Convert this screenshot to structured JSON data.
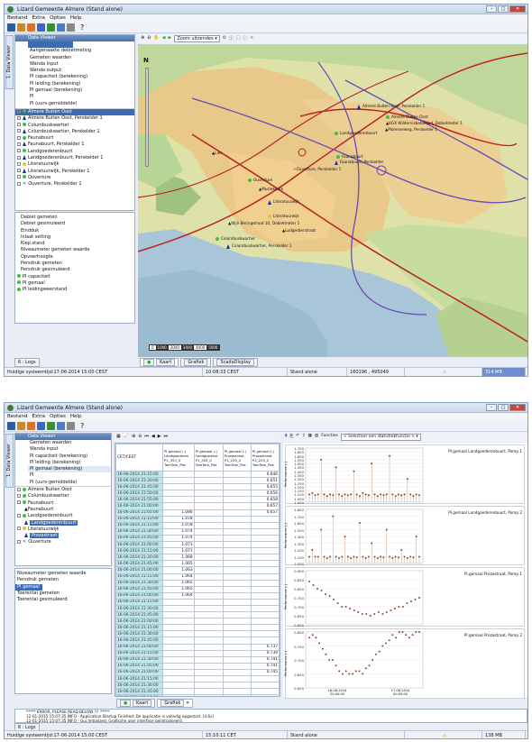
{
  "app": {
    "title": "Lizard Gemeente Almere (Stand alone)",
    "title2": "Lizard Gemeente Almere (Stand alone)"
  },
  "menu": [
    "Bestand",
    "Extra",
    "Opties",
    "Help"
  ],
  "data_viewer": {
    "title": "Data Viewer",
    "side_tab": "1: Data Viewer",
    "logs_tab": "6 : Logs"
  },
  "tree_top": [
    "Aangenaakte debietmeting",
    "Gemeten waarden",
    "Wanda input",
    "Wanda output",
    "PI capaciteit (berekening)",
    "PI leiding (berekening)",
    "PI gemaal (berekening)",
    "PI",
    "PI (uurs-gemiddelde)"
  ],
  "tree_locations": [
    "Almere Buiten Oost",
    "Almere Buiten Oost, Perskelder 1",
    "Columbuskwartier",
    "Columbuskwartier, Perskelder 1",
    "Faunabuurt",
    "Faunabuurt, Perskelder 1",
    "Landgoederenbuurt",
    "Landgoederenbuurt, Perskelder 1",
    "Literatuurwijk",
    "Literatuurwijk, Perskelder 1",
    "Ouverture",
    "Ouverture, Perskelder 1"
  ],
  "params": [
    "Debiet gemeten",
    "Debiet gesimuleerd",
    "Eindduk",
    "Inlaat setting",
    "Klep.stand",
    "Niveaumeter gemeten waarde",
    "Opvoerhoogte",
    "Persdruk gemeten",
    "Persdruk gesimuleerd",
    "PI capaciteit",
    "PI gemaal",
    "PI leidingweerstand"
  ],
  "map": {
    "zoom_option": "Zoom uitzendes",
    "scale_labels": [
      "1000",
      "2000",
      "3000",
      "4000",
      "5000"
    ],
    "north": "N",
    "labels": [
      "Almere Buiten Oost, Perskelder 1",
      "Almere Buiten Oost",
      "KGX Wildernisbebouwd, Debietmeter 1",
      "Molenveweg, Perskelder 1",
      "Landgoederenbuurt",
      "Faunabuurt",
      "Faunabuurt, Perskelder",
      "Lies",
      "Ouverture, Perskelder 1",
      "Ouverture",
      "Muziekpark",
      "Literatuurwijk",
      "Literatuurwijk",
      "Wijn Beringstraat 10, Debietmeter 1",
      "Ludgerberstraat",
      "Columbuskwartier",
      "Columbuskwartier, Perskelder 1"
    ]
  },
  "bottom_tabs": [
    "Kaart",
    "Grafiek",
    "ScadaDisplay"
  ],
  "status1": [
    "Huidige systeemtijd:17-06-2014 15:00 CEST",
    "10:08:33 CEST",
    "Stand alone",
    "160196 , 495049",
    "",
    "314 MB"
  ],
  "table": {
    "headers": [
      "CET/CEST",
      "PI gemaal (-) Landgoederen P1_353_0 TamTam_Pos",
      "PI gemaal (-) Landgoedere P1_353_0 TamTam_Pos",
      "PI gemaal (-) Prozastraat, P1_229_0 TamTam_Pos",
      "PI gemaal (-) Prozastraat, P2_229_0 TamTam_Pos"
    ],
    "times": [
      "16-06-2014 21:15:00",
      "16-06-2014 21:30:00",
      "16-06-2014 21:45:00",
      "16-06-2014 21:50:00",
      "16-06-2014 21:55:00",
      "16-06-2014 21:00:00",
      "16-06-2014 21:05:00",
      "16-06-2014 21:10:00",
      "16-06-2014 21:15:00",
      "16-06-2014 21:30:00",
      "16-06-2014 21:45:00",
      "16-06-2014 21:00:00",
      "16-06-2014 21:15:00",
      "16-06-2014 21:30:00",
      "16-06-2014 21:45:00",
      "16-06-2014 21:00:00",
      "16-06-2014 21:15:00",
      "16-06-2014 21:30:00",
      "16-06-2014 21:45:00",
      "16-06-2014 21:00:00",
      "16-06-2014 21:15:00",
      "16-06-2014 21:30:00",
      "16-06-2014 21:45:00",
      "16-06-2014 21:00:00",
      "16-06-2014 21:15:00",
      "16-06-2014 21:30:00",
      "16-06-2014 21:45:00",
      "16-06-2014 21:00:00",
      "16-06-2014 21:15:00",
      "16-06-2014 21:30:00",
      "16-06-2014 21:45:00",
      "16-06-2014 21:00:00",
      "16-06-2014 21:15:00",
      "16-06-2014 21:30:00",
      "16-06-2014 21:45:00",
      "16-06-2014 21:00:00",
      "16-06-2014 21:15:00",
      "16-06-2014 21:30:00",
      "16-06-2014 21:45:00"
    ],
    "c2": [
      "",
      "",
      "",
      "",
      "",
      "",
      "1.086",
      "1.078",
      "1.078",
      "1.074",
      "1.074",
      "1.073",
      "1.071",
      "1.068",
      "1.065",
      "1.063",
      "1.064",
      "1.065",
      "1.065",
      "1.064",
      "",
      "",
      "",
      "",
      "",
      "",
      "",
      "",
      "",
      "",
      "",
      "",
      "",
      "",
      "",
      "",
      "",
      "",
      ""
    ],
    "c4": [
      "0.646",
      "0.651",
      "0.655",
      "0.656",
      "0.658",
      "0.657",
      "0.657",
      "",
      "",
      "",
      "",
      "",
      "",
      "",
      "",
      "",
      "",
      "",
      "",
      "",
      "",
      "",
      "",
      "",
      "",
      "",
      "",
      "0.737",
      "0.739",
      "0.741",
      "0.741",
      "0.745",
      "",
      "",
      "",
      "",
      "",
      "",
      ""
    ]
  },
  "chart_toolbar": {
    "functions": "Functies",
    "select": "< Selecteer een statistiekfunctie >"
  },
  "chart_data": [
    {
      "type": "scatter",
      "series": [
        {
          "name": "PI.gemaal Landgoederenbuurt, Pomp 1",
          "values": [
            1.1,
            1.12,
            1.09,
            1.1,
            1.55,
            1.1,
            1.08,
            1.1,
            1.09,
            1.45,
            1.1,
            1.08,
            1.1,
            1.09,
            1.1,
            1.4,
            1.1,
            1.08,
            1.12,
            1.1,
            1.09,
            1.5,
            1.1,
            1.08,
            1.1,
            1.09,
            1.1,
            1.6,
            1.1,
            1.08,
            1.1,
            1.09,
            1.1,
            1.3,
            1.1,
            1.08,
            1.1,
            1.09
          ]
        }
      ],
      "ylabel": "Performance (-)",
      "ylim": [
        1.0,
        1.7
      ],
      "yticks": [
        "1.700",
        "1.650",
        "1.600",
        "1.550",
        "1.500",
        "1.450",
        "1.400",
        "1.350",
        "1.300",
        "1.250",
        "1.200",
        "1.150",
        "1.100",
        "1.050",
        "1.000"
      ]
    },
    {
      "type": "scatter",
      "series": [
        {
          "name": "PI.gemaal Landgoederenbuurt, Pomp 2",
          "values": [
            1.1,
            1.2,
            1.1,
            1.1,
            1.5,
            1.1,
            1.08,
            1.1,
            1.7,
            1.1,
            1.08,
            1.1,
            1.4,
            1.1,
            1.08,
            1.1,
            1.09,
            1.6,
            1.1,
            1.08,
            1.1,
            1.3,
            1.1,
            1.08,
            1.1,
            1.09,
            1.5,
            1.1,
            1.08,
            1.1,
            1.09,
            1.2,
            1.1,
            1.08,
            1.1,
            1.09,
            1.4,
            1.1
          ]
        }
      ],
      "ylabel": "Performance (-)",
      "ylim": [
        1.0,
        1.8
      ],
      "yticks": [
        "1.800",
        "1.700",
        "1.600",
        "1.500",
        "1.400",
        "1.300",
        "1.200",
        "1.100",
        "1.000"
      ]
    },
    {
      "type": "scatter",
      "series": [
        {
          "name": "PI.gemaal Prozastraat, Pomp 1",
          "values": [
            0.84,
            0.82,
            0.8,
            0.79,
            0.77,
            0.76,
            0.74,
            0.72,
            0.7,
            0.7,
            0.69,
            0.68,
            0.67,
            0.66,
            0.66,
            0.65,
            0.66,
            0.67,
            0.66,
            0.67,
            0.68,
            0.69,
            0.7,
            0.7,
            0.72,
            0.73,
            0.74,
            0.75
          ]
        }
      ],
      "ylabel": "Performance (-)",
      "ylim": [
        0.6,
        0.9
      ],
      "yticks": [
        "0.900",
        "0.850",
        "0.800",
        "0.750",
        "0.700",
        "0.650",
        "0.600"
      ]
    },
    {
      "type": "scatter",
      "series": [
        {
          "name": "PI.gemaal Prozastraat, Pomp 2",
          "values": [
            0.78,
            0.79,
            0.78,
            0.76,
            0.74,
            0.72,
            0.7,
            0.7,
            0.68,
            0.66,
            0.65,
            0.66,
            0.65,
            0.65,
            0.66,
            0.66,
            0.65,
            0.67,
            0.68,
            0.7,
            0.72,
            0.73,
            0.75,
            0.76,
            0.77,
            0.79,
            0.78,
            0.8,
            0.8,
            0.79,
            0.78,
            0.79,
            0.8,
            0.8
          ]
        }
      ],
      "ylabel": "Performance (-)",
      "ylim": [
        0.6,
        0.8
      ],
      "yticks": [
        "0.800",
        "0.750",
        "0.700",
        "0.650",
        "0.600"
      ],
      "xticks": [
        "16-06-2014 20:00:00",
        "17-06-2014 00:00:00"
      ]
    }
  ],
  "params2": [
    "Niveaumeter gemeten waarde",
    "Persdruk gemeten",
    "PI gemaal",
    "Toerental gemeten",
    "Toerental gesimuleerd"
  ],
  "tree2": [
    "Almere Buiten Oost",
    "Columbuskwartier",
    "Faunabuurt",
    "Faunabuurt",
    "Landgoederenbuurt",
    "Landgoederenbuurt",
    "Literatuurwijk",
    "Prozastraat",
    "Ouverture"
  ],
  "bottom_tabs2": [
    "Kaart",
    "Grafiek"
  ],
  "logs": [
    "***** ERROR, PLEASE READ BELOW !!! *****",
    "12-01-2015 15:07:35 INFO - Application.Startup.Finished: De applicatie is volledig opgestart. [4.6s]",
    "12-01-2015 15:07:35 INFO - Gui.Initialized: Grafische user interface geïnitialiseerd."
  ],
  "status2": [
    "Huidige systeemtijd:17-06-2014 15:00 CEST",
    "15:10:11 CET",
    "Stand alone",
    "",
    "138 MB"
  ]
}
